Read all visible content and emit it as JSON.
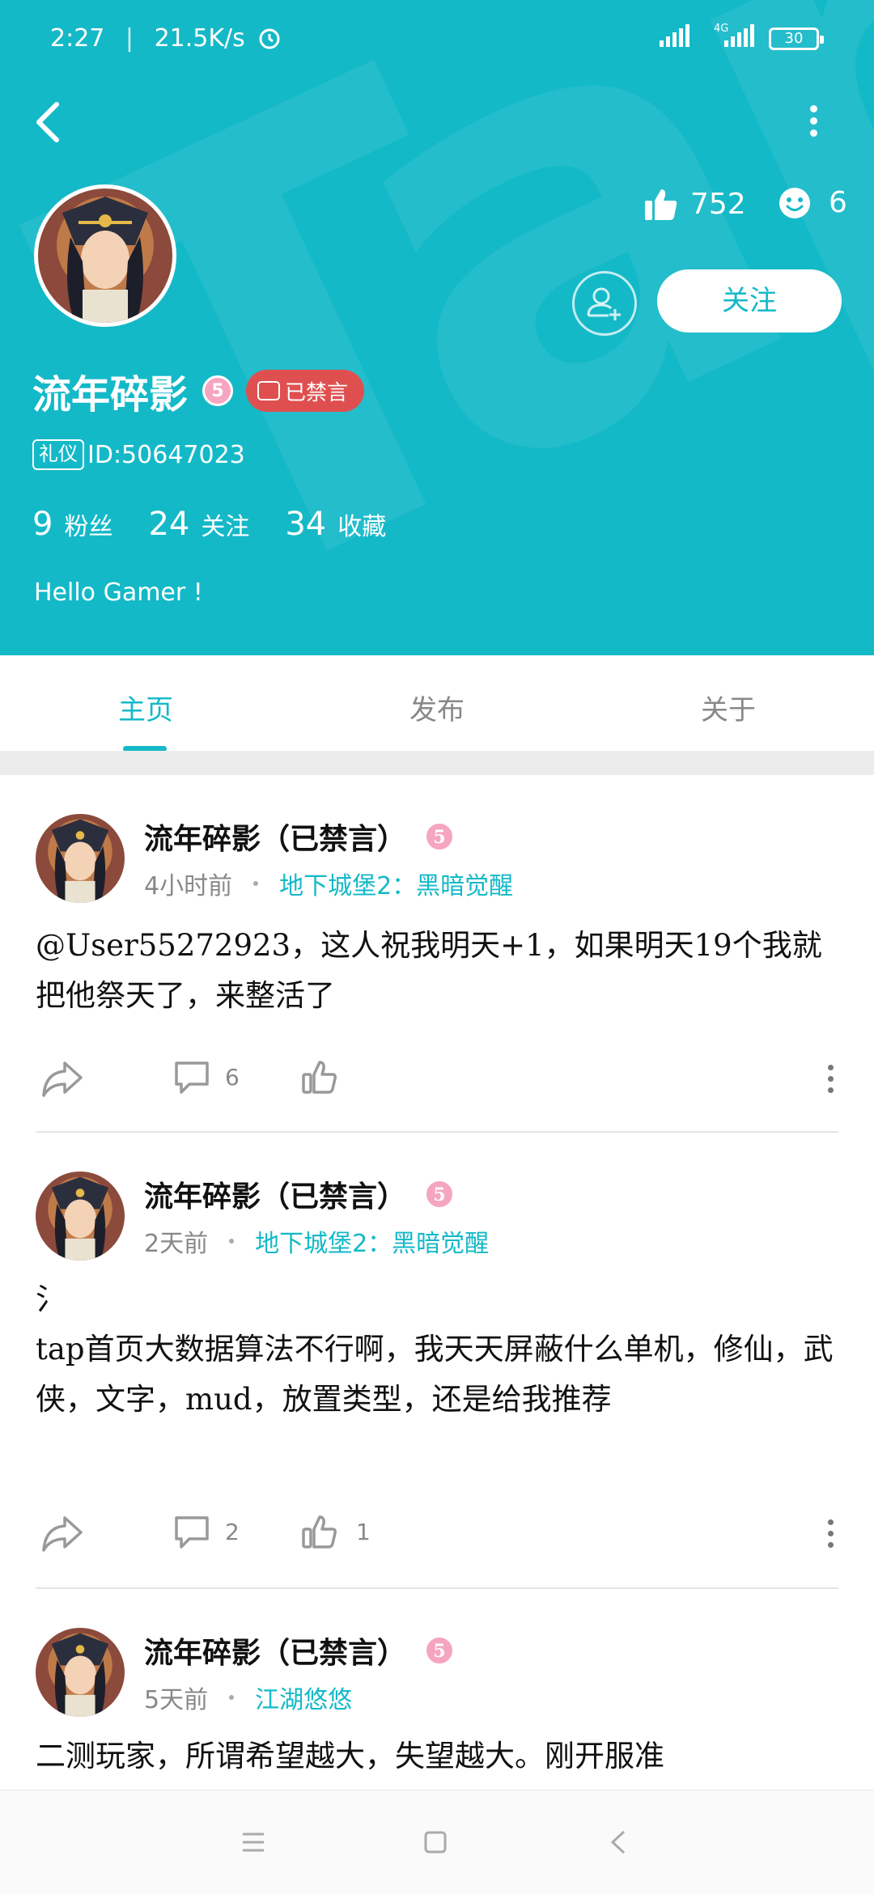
{
  "status_bar": {
    "time": "2:27",
    "net_speed": "21.5K/s",
    "network": "4G",
    "battery": "30"
  },
  "header": {
    "watermark": "TapTap",
    "likes_count": "752",
    "faces_count": "6",
    "follow_label": "关注",
    "username": "流年碎影",
    "level": "5",
    "banned_label": "已禁言",
    "tag": "礼仪",
    "user_id": "ID:50647023",
    "stats": [
      {
        "num": "9",
        "label": "粉丝"
      },
      {
        "num": "24",
        "label": "关注"
      },
      {
        "num": "34",
        "label": "收藏"
      }
    ],
    "bio": "Hello Gamer !",
    "accent": "#14b9c8",
    "banned_color": "#e04f4f"
  },
  "tabs": [
    {
      "label": "主页",
      "active": true
    },
    {
      "label": "发布",
      "active": false
    },
    {
      "label": "关于",
      "active": false
    }
  ],
  "posts": [
    {
      "author": "流年碎影（已禁言）",
      "level": "5",
      "time": "4小时前",
      "game": "地下城堡2：黑暗觉醒",
      "content": "@User55272923，这人祝我明天+1，如果明天19个我就把他祭天了，来整活了",
      "comments": "6",
      "likes": ""
    },
    {
      "author": "流年碎影（已禁言）",
      "level": "5",
      "time": "2天前",
      "game": "地下城堡2：黑暗觉醒",
      "content_line1": "氵",
      "content": "tap首页大数据算法不行啊，我天天屏蔽什么单机，修仙，武侠，文字，mud，放置类型，还是给我推荐",
      "comments": "2",
      "likes": "1"
    },
    {
      "author": "流年碎影（已禁言）",
      "level": "5",
      "time": "5天前",
      "game": "江湖悠悠",
      "content": "二测玩家，所谓希望越大，失望越大。刚开服准"
    }
  ],
  "icons": {
    "back": "chevron-left-icon",
    "more": "more-vertical-icon",
    "like": "thumbs-up-icon",
    "face": "smiley-icon",
    "share": "share-icon",
    "comment": "comment-icon",
    "nav": [
      "menu-icon",
      "home-square-icon",
      "back-triangle-icon"
    ]
  }
}
